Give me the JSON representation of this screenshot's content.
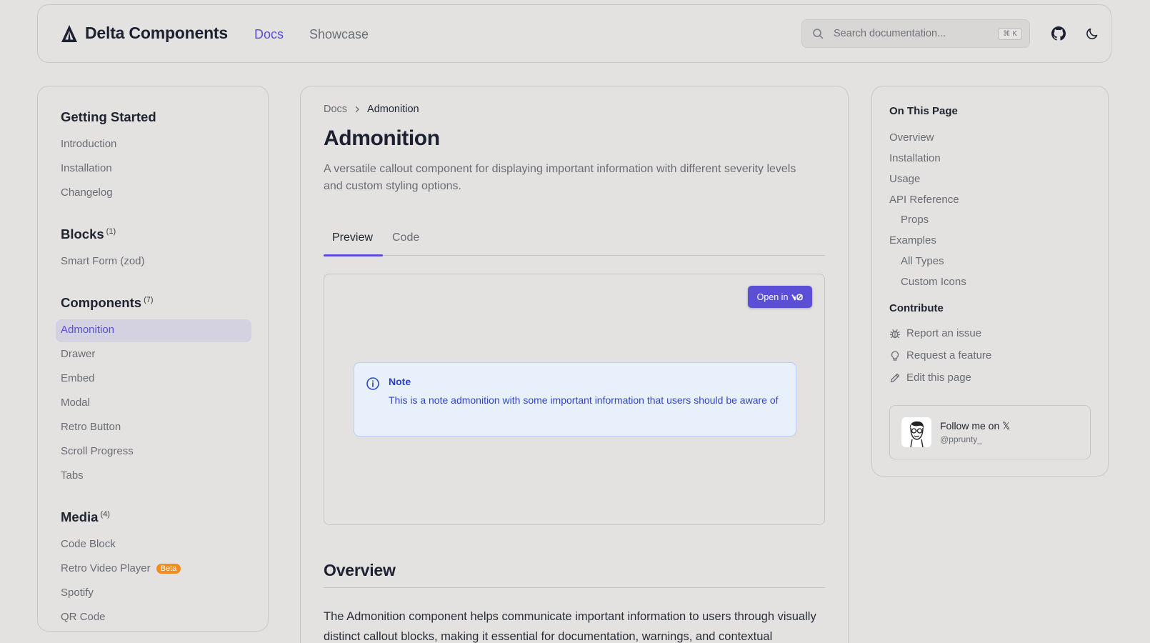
{
  "header": {
    "brand": "Delta Components",
    "nav": {
      "docs": "Docs",
      "showcase": "Showcase"
    },
    "search": {
      "placeholder": "Search documentation...",
      "shortcut": "⌘ K"
    }
  },
  "sidebar": {
    "sections": {
      "getting_started": {
        "title": "Getting Started",
        "items": [
          "Introduction",
          "Installation",
          "Changelog"
        ]
      },
      "blocks": {
        "title": "Blocks",
        "count": "(1)",
        "items": [
          "Smart Form (zod)"
        ]
      },
      "components": {
        "title": "Components",
        "count": "(7)",
        "items": [
          "Admonition",
          "Drawer",
          "Embed",
          "Modal",
          "Retro Button",
          "Scroll Progress",
          "Tabs"
        ]
      },
      "media": {
        "title": "Media",
        "count": "(4)",
        "items": [
          "Code Block",
          "Retro Video Player",
          "Spotify",
          "QR Code"
        ],
        "beta_badge": "Beta"
      }
    },
    "active_item": "Admonition"
  },
  "main": {
    "breadcrumb": {
      "root": "Docs",
      "current": "Admonition"
    },
    "title": "Admonition",
    "subtitle": "A versatile callout component for displaying important information with different severity levels and custom styling options.",
    "tabs": {
      "preview": "Preview",
      "code": "Code"
    },
    "open_in_label": "Open in",
    "note": {
      "title": "Note",
      "text": "This is a note admonition with some important information that users should be aware of"
    },
    "overview": {
      "heading": "Overview",
      "text": "The Admonition component helps communicate important information to users through visually distinct callout blocks, making it essential for documentation, warnings, and contextual"
    }
  },
  "toc": {
    "heading": "On This Page",
    "items": {
      "overview": "Overview",
      "installation": "Installation",
      "usage": "Usage",
      "api_reference": "API Reference",
      "props": "Props",
      "examples": "Examples",
      "all_types": "All Types",
      "custom_icons": "Custom Icons"
    },
    "contribute": {
      "heading": "Contribute",
      "report": "Report an issue",
      "request": "Request a feature",
      "edit": "Edit this page"
    },
    "follow": {
      "title": "Follow me on 𝕏",
      "handle": "@pprunty_"
    }
  },
  "colors": {
    "accent": "#5a4fd6",
    "background": "#e3e2e0",
    "note_bg": "#e8f0fb",
    "note_text": "#2f45c6",
    "beta": "#f28c1e"
  },
  "icons": {
    "brand": "delta-logo-icon",
    "search": "search-icon",
    "github": "github-icon",
    "theme": "moon-icon",
    "note": "info-icon",
    "report": "bug-icon",
    "request": "lightbulb-icon",
    "edit": "pencil-icon"
  }
}
